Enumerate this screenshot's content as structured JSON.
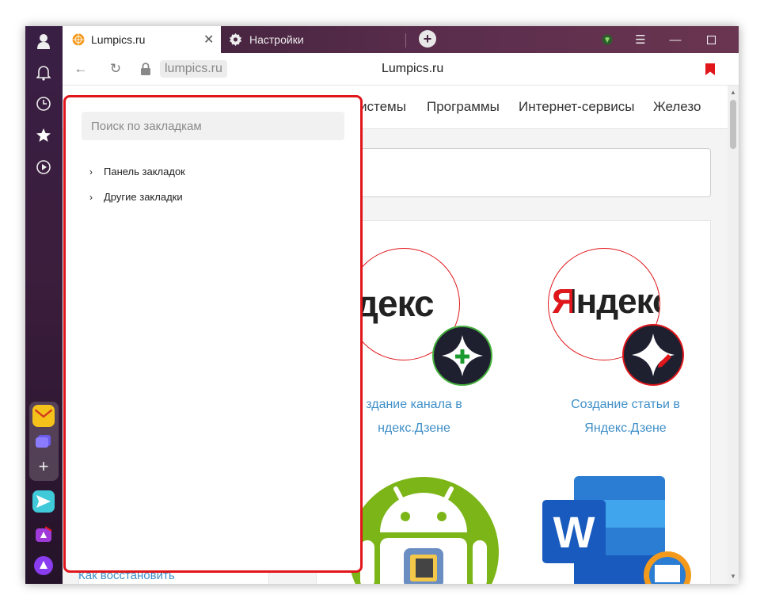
{
  "tabs": [
    {
      "title": "Lumpics.ru",
      "icon": "orange-favicon-icon",
      "active": true
    },
    {
      "title": "Настройки",
      "icon": "gear-icon",
      "active": false
    }
  ],
  "address": {
    "url": "lumpics.ru",
    "page_title": "Lumpics.ru"
  },
  "nav_menu": [
    "истемы",
    "Программы",
    "Интернет-сервисы",
    "Железо"
  ],
  "bookmarks": {
    "search_placeholder": "Поиск по закладкам",
    "folders": [
      "Панель закладок",
      "Другие закладки"
    ]
  },
  "cards": [
    {
      "logo": "ндекс",
      "title_line1": "здание канала в",
      "title_line2": "ндекс.Дзене"
    },
    {
      "logo": "Яндекс",
      "title_line1": "Создание статьи в",
      "title_line2": "Яндекс.Дзене"
    }
  ],
  "left_link": "Как восстановить",
  "colors": {
    "accent_red": "#e0161b",
    "link_blue": "#3f8fc8",
    "sidebar": "#3a1f45"
  }
}
